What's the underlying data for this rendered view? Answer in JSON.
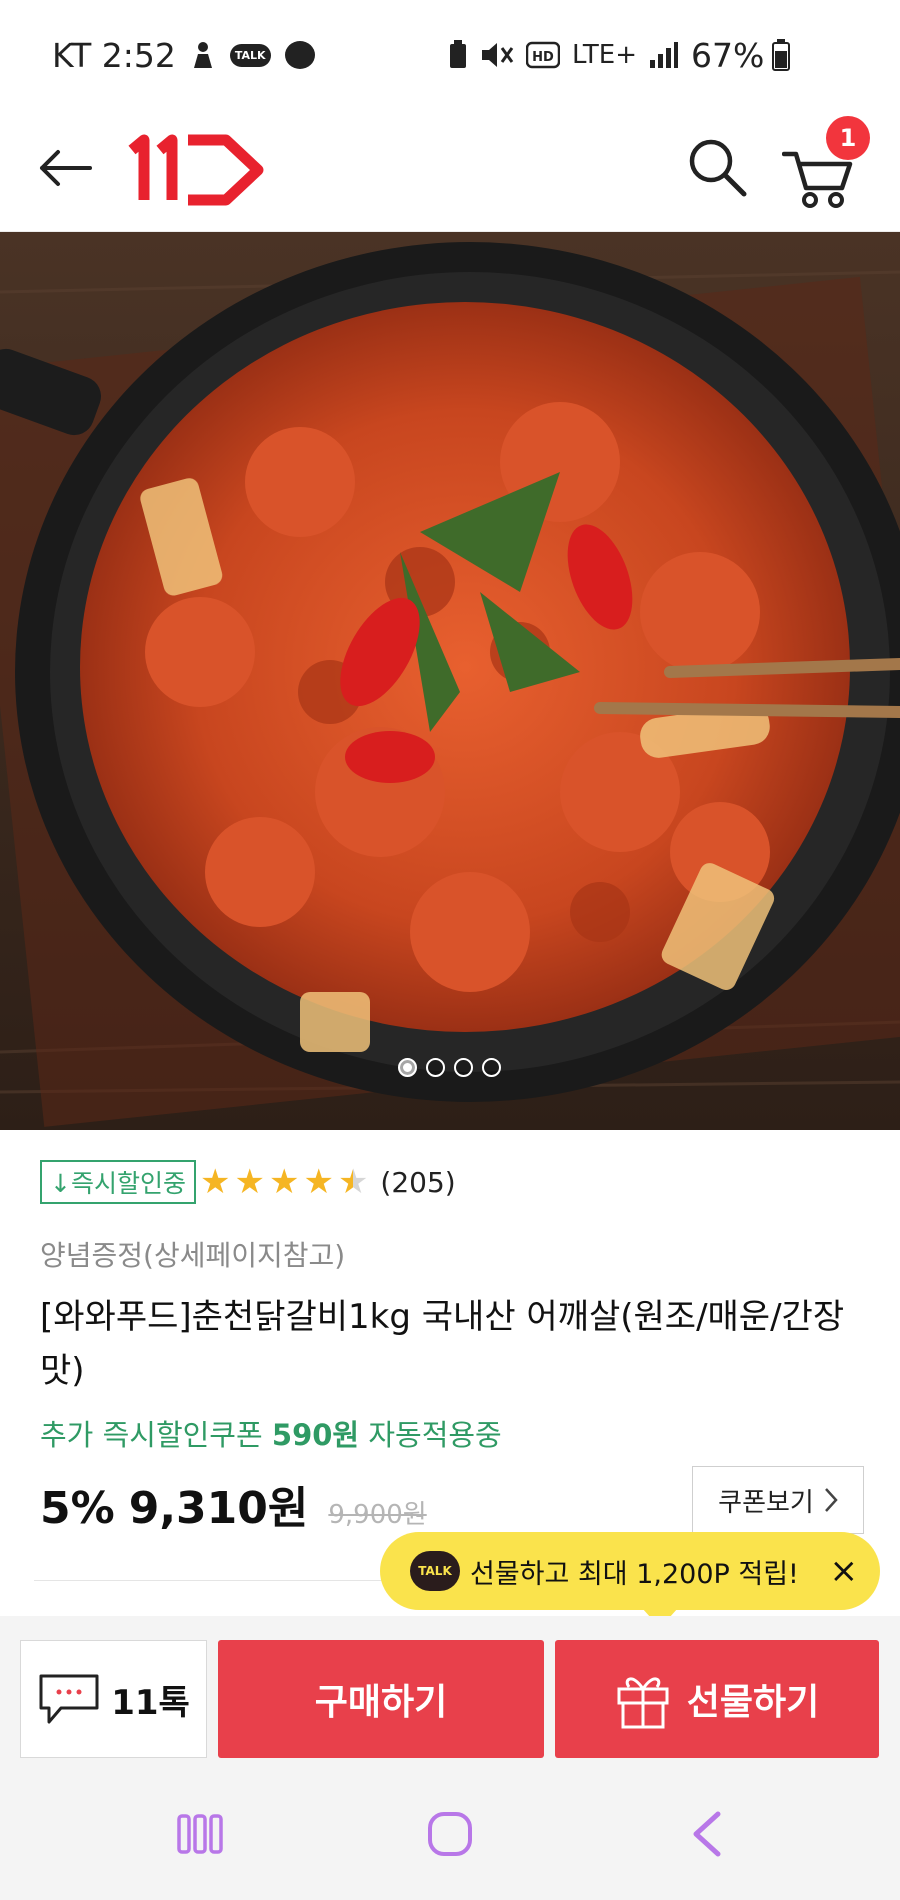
{
  "status_bar": {
    "carrier_time": "KT 2:52",
    "talk_label": "TALK",
    "network": "LTE+",
    "battery": "67%"
  },
  "header": {
    "logo_text": "11"
  },
  "cart": {
    "count": "1"
  },
  "carousel": {
    "total": 4,
    "active": 1
  },
  "product": {
    "cert_badge": "↓즉시할인중",
    "rating": 4.5,
    "review_count": "(205)",
    "subtitle": "양념증정(상세페이지참고)",
    "title": "[와와푸드]춘천닭갈비1kg 국내산 어깨살(원조/매운/간장맛)",
    "coupon_prefix": "추가 즉시할인쿠폰 ",
    "coupon_amount": "590원",
    "coupon_suffix": " 자동적용중",
    "discount": "5%",
    "price": "9,310원",
    "original_price": "9,900원",
    "coupon_view_label": "쿠폰보기"
  },
  "tooltip": {
    "kakao_label": "TALK",
    "text": "선물하고 최대 1,200P 적립!",
    "close": "×"
  },
  "actions": {
    "talk_label": "11톡",
    "buy_label": "구매하기",
    "gift_label": "선물하기"
  },
  "colors": {
    "brand_red": "#e8404b",
    "badge_red": "#f2353d",
    "coupon_green": "#2f9a64",
    "star_gold": "#f5b523",
    "tooltip_yellow": "#fae34c",
    "nav_purple": "#b877e8"
  },
  "icons": {
    "back": "arrow-left-icon",
    "search": "search-icon",
    "cart": "cart-icon",
    "chat": "chat-bubble-icon",
    "gift": "gift-icon",
    "recents": "recent-apps-icon",
    "home": "home-icon",
    "nav_back": "chevron-left-icon"
  }
}
